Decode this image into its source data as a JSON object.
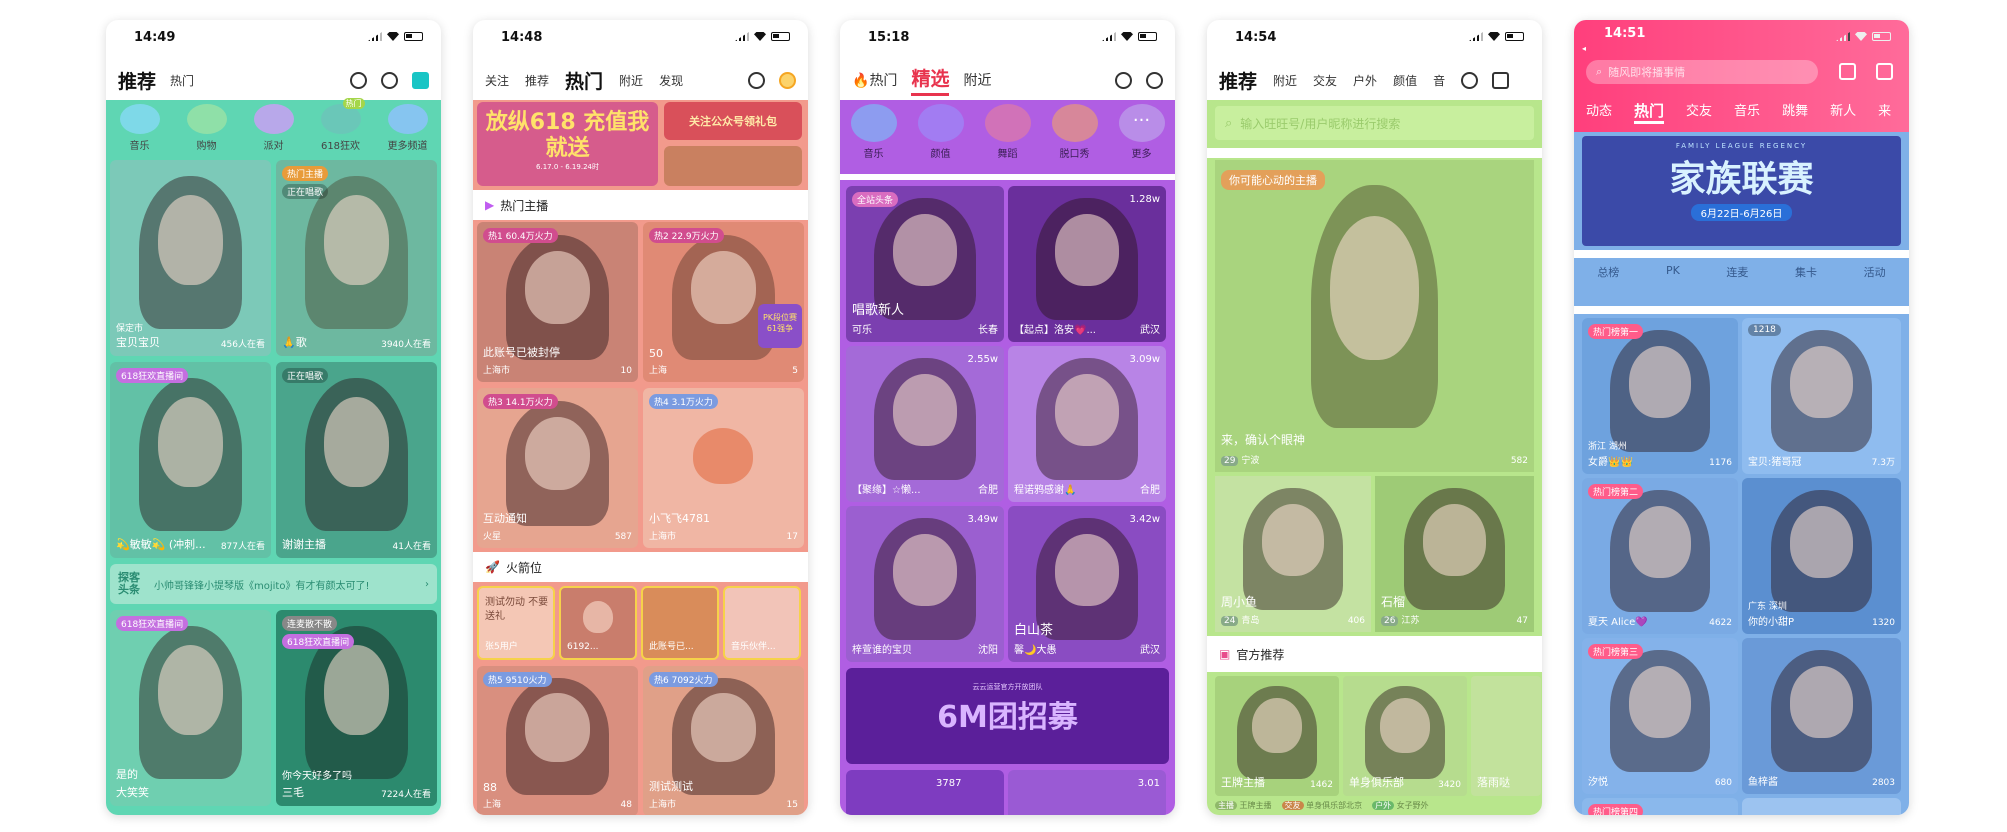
{
  "p1": {
    "time": "14:49",
    "tabs": [
      "推荐",
      "热门"
    ],
    "categories": [
      "音乐",
      "购物",
      "派对",
      "618狂欢",
      "更多频道"
    ],
    "cat_badge": "热门",
    "tiles": [
      {
        "tag": "",
        "top": "保定市",
        "cap": "宝贝宝贝",
        "cnt": "456人在看"
      },
      {
        "tag": "热门主播",
        "top": "正在唱歌",
        "cap": "🙏歌",
        "cnt": "3940人在看"
      },
      {
        "tag": "618狂欢直播间",
        "top": "",
        "cap": "💫敏敏💫 (冲刺...",
        "cnt": "877人在看"
      },
      {
        "tag": "正在唱歌",
        "top": "",
        "cap": "谢谢主播",
        "cnt": "41人在看"
      },
      {
        "tag": "618狂欢直播间",
        "top": "",
        "cap": "大笑笑",
        "cnt": ""
      },
      {
        "tag": "连麦散不散",
        "top": "618狂欢直播间",
        "cap": "三毛",
        "cnt": "7224人在看"
      }
    ],
    "banner_tag": "探客头条",
    "banner_text": "小帅哥锋锋小提琴版《mojito》有才有颜太可了!",
    "banner_cap_a": "是的",
    "banner_cap_b": "你今天好多了吗"
  },
  "p2": {
    "time": "14:48",
    "tabs": [
      "关注",
      "推荐",
      "热门",
      "附近",
      "发现"
    ],
    "banner_a": "放纵618 充值我就送",
    "banner_a_sub": "6.17.0 - 6.19.24时",
    "banner_b": "关注公众号领礼包",
    "section1": "热门主播",
    "section2": "火箭位",
    "tiles": [
      {
        "tag": "热1",
        "heat": "60.4万火力",
        "cap": "此账号已被封停",
        "loc": "上海市",
        "cnt": "10"
      },
      {
        "tag": "热2",
        "heat": "22.9万火力",
        "cap": "50",
        "loc": "上海",
        "cnt": "5"
      },
      {
        "tag": "热3",
        "heat": "14.1万火力",
        "cap": "互动通知",
        "loc": "火星",
        "cnt": "587"
      },
      {
        "tag": "热4",
        "heat": "3.1万火力",
        "cap": "小飞飞4781",
        "loc": "上海市",
        "cnt": "17"
      },
      {
        "tag": "热5",
        "heat": "9510火力",
        "cap": "88",
        "loc": "上海",
        "cnt": "48"
      },
      {
        "tag": "热6",
        "heat": "7092火力",
        "cap": "测试测试",
        "loc": "上海市",
        "cnt": "15"
      }
    ],
    "rockets": [
      "张5用户",
      "6192...",
      "此账号已...",
      "音乐伙伴..."
    ],
    "rocket_text": "测试勿动 不要送礼",
    "pk_badge": "PK段位赛 61强争"
  },
  "p3": {
    "time": "15:18",
    "tabs": [
      "热门",
      "精选",
      "附近"
    ],
    "categories": [
      "音乐",
      "颜值",
      "舞蹈",
      "脱口秀",
      "更多"
    ],
    "tiles": [
      {
        "tag": "全站头条",
        "heat": "",
        "cap": "唱歌新人",
        "name": "可乐",
        "loc": "长春"
      },
      {
        "tag": "",
        "heat": "1.28w",
        "cap": "",
        "name": "【起点】洛安💗...",
        "loc": "武汉"
      },
      {
        "tag": "",
        "heat": "2.55w",
        "cap": "",
        "name": "【聚缘】☆懒...",
        "loc": "合肥"
      },
      {
        "tag": "",
        "heat": "3.09w",
        "cap": "",
        "name": "程诺鸦感谢🙏",
        "loc": "合肥"
      },
      {
        "tag": "",
        "heat": "3.49w",
        "cap": "",
        "name": "梓萱谁的宝贝",
        "loc": "沈阳"
      },
      {
        "tag": "",
        "heat": "3.42w",
        "cap": "白山茶",
        "name": "馨🌙大愚",
        "loc": "武汉"
      }
    ],
    "banner": "6M团招募",
    "banner_sub": "云云运营官方开放团队",
    "bottom_heat": [
      "3787",
      "3.01"
    ]
  },
  "p4": {
    "time": "14:54",
    "tabs": [
      "推荐",
      "附近",
      "交友",
      "户外",
      "颜值",
      "音"
    ],
    "search_placeholder": "输入旺旺号/用户昵称进行搜索",
    "hero_tag": "你可能心动的主播",
    "hero_cap": "来，确认个眼神",
    "hero_level": "29",
    "hero_loc": "宁波",
    "hero_cnt": "582",
    "tiles": [
      {
        "cap": "周小鱼",
        "level": "24",
        "loc": "青岛",
        "cnt": "406"
      },
      {
        "cap": "石榴",
        "level": "26",
        "loc": "江苏",
        "cnt": "47"
      }
    ],
    "section": "官方推荐",
    "recs": [
      {
        "cap": "王牌主播",
        "cnt": "1462",
        "tag": "主播",
        "sub": "王牌主播"
      },
      {
        "cap": "单身俱乐部",
        "cnt": "3420",
        "tag": "交友",
        "sub": "单身俱乐部北京"
      },
      {
        "cap": "落雨哒",
        "cnt": "",
        "tag": "户外",
        "sub": "女子野外"
      }
    ]
  },
  "p5": {
    "time": "14:51",
    "search_placeholder": "随风即将播事情",
    "tabs": [
      "动态",
      "热门",
      "交友",
      "音乐",
      "跳舞",
      "新人",
      "来"
    ],
    "banner_en": "FAMILY LEAGUE REGENCY",
    "banner": "家族联赛",
    "banner_date": "6月22日-6月26日",
    "quick": [
      "总榜",
      "PK",
      "连麦",
      "集卡",
      "活动"
    ],
    "tiles": [
      {
        "tag": "热门榜第一",
        "loc": "浙江 湖州",
        "name": "女爵👑👑",
        "cnt": "1176"
      },
      {
        "tag": "1218",
        "loc": "",
        "name": "宝贝:猪哥冠",
        "cnt": "7.3万"
      },
      {
        "tag": "热门榜第二",
        "loc": "",
        "name": "夏天 Alice💜",
        "cnt": "4622"
      },
      {
        "tag": "",
        "loc": "广东 深圳",
        "name": "你的小甜P",
        "cnt": "1320"
      },
      {
        "tag": "热门榜第三",
        "loc": "",
        "name": "汐悦",
        "cnt": "680"
      },
      {
        "tag": "",
        "loc": "",
        "name": "鱼梓酱",
        "cnt": "2803"
      },
      {
        "tag": "热门榜第四",
        "loc": "",
        "name": "",
        "cnt": ""
      }
    ]
  },
  "colors": {
    "p1": "#5fd6b3",
    "p2": "#f29a8c",
    "p3": "#b05ee3",
    "p4": "#b8e68c",
    "p5": "#7fb0e8",
    "p5_head": "#ff3f7c"
  }
}
